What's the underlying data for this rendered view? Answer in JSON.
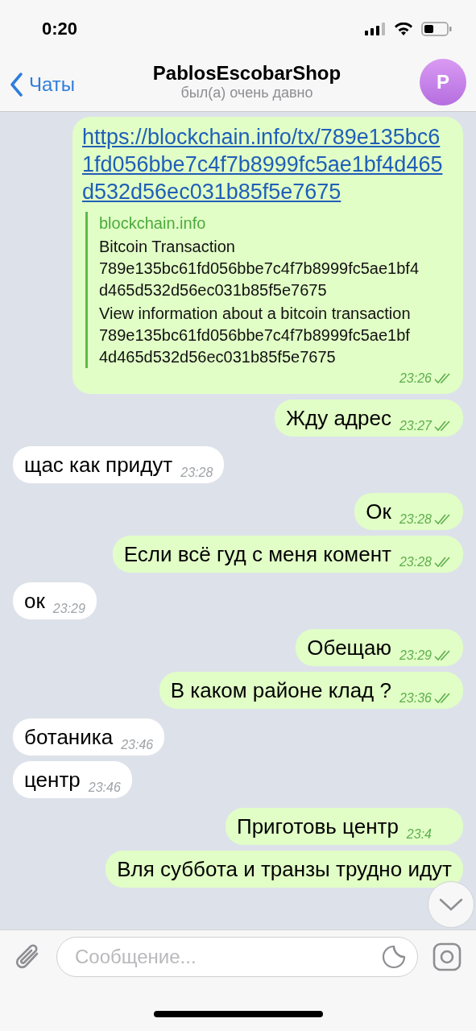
{
  "status_bar": {
    "time": "0:20"
  },
  "nav": {
    "back": "Чаты",
    "title": "PablosEscobarShop",
    "subtitle": "был(а) очень давно",
    "avatar": "P"
  },
  "messages": [
    {
      "kind": "link",
      "outgoing": true,
      "url": "https://blockchain.info/tx/789e135bc61fd056bbe7c4f7b8999fc5ae1bf4d465d532d56ec031b85f5e7675",
      "preview_site": "blockchain.info",
      "preview_title": "Bitcoin Transaction 789e135bc61fd056bbe7c4f7b8999fc5ae1bf4d465d532d56ec031b85f5e7675",
      "preview_description": "View information about a bitcoin transaction 789e135bc61fd056bbe7c4f7b8999fc5ae1bf4d465d532d56ec031b85f5e7675",
      "time": "23:26",
      "read": true
    },
    {
      "kind": "text",
      "outgoing": true,
      "text": "Жду адрес",
      "time": "23:27",
      "read": true
    },
    {
      "kind": "text",
      "outgoing": false,
      "text": "щас как придут",
      "time": "23:28"
    },
    {
      "kind": "text",
      "outgoing": true,
      "text": "Ок",
      "time": "23:28",
      "read": true
    },
    {
      "kind": "text",
      "outgoing": true,
      "text": "Если всё гуд с меня комент",
      "time": "23:28",
      "read": true
    },
    {
      "kind": "text",
      "outgoing": false,
      "text": "ок",
      "time": "23:29"
    },
    {
      "kind": "text",
      "outgoing": true,
      "text": "Обещаю",
      "time": "23:29",
      "read": true
    },
    {
      "kind": "text",
      "outgoing": true,
      "text": "В каком районе клад ?",
      "time": "23:36",
      "read": true
    },
    {
      "kind": "text",
      "outgoing": false,
      "text": "ботаника",
      "time": "23:46"
    },
    {
      "kind": "text",
      "outgoing": false,
      "text": "центр",
      "time": "23:46"
    },
    {
      "kind": "text",
      "outgoing": true,
      "text": "Приготовь центр",
      "time": "23:4"
    },
    {
      "kind": "text",
      "outgoing": true,
      "text": "Вля суббота и транзы трудно идут"
    }
  ],
  "composer": {
    "placeholder": "Сообщение..."
  }
}
